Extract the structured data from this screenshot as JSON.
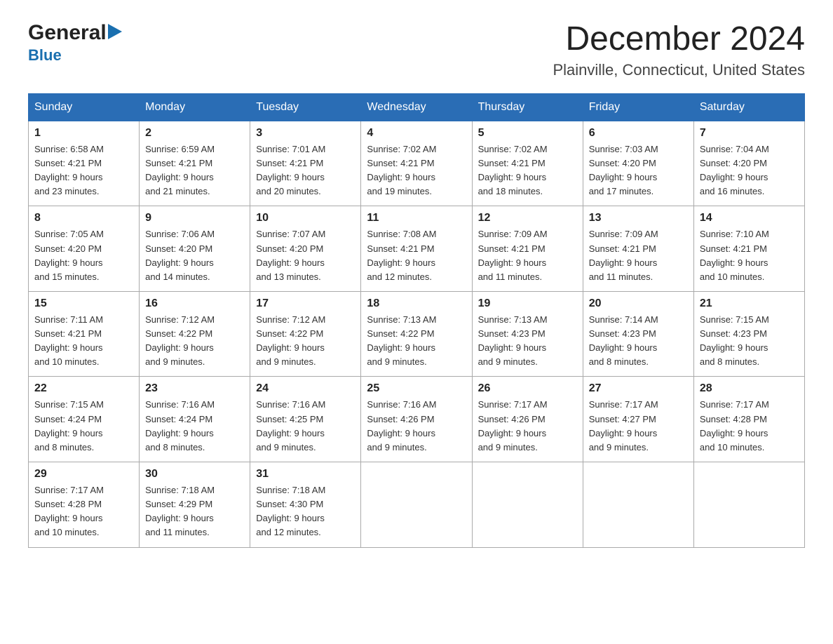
{
  "logo": {
    "general": "General",
    "blue": "Blue",
    "arrow_unicode": "▶"
  },
  "header": {
    "month_title": "December 2024",
    "location": "Plainville, Connecticut, United States"
  },
  "weekdays": [
    "Sunday",
    "Monday",
    "Tuesday",
    "Wednesday",
    "Thursday",
    "Friday",
    "Saturday"
  ],
  "weeks": [
    [
      {
        "num": "1",
        "sunrise": "6:58 AM",
        "sunset": "4:21 PM",
        "daylight": "9 hours and 23 minutes."
      },
      {
        "num": "2",
        "sunrise": "6:59 AM",
        "sunset": "4:21 PM",
        "daylight": "9 hours and 21 minutes."
      },
      {
        "num": "3",
        "sunrise": "7:01 AM",
        "sunset": "4:21 PM",
        "daylight": "9 hours and 20 minutes."
      },
      {
        "num": "4",
        "sunrise": "7:02 AM",
        "sunset": "4:21 PM",
        "daylight": "9 hours and 19 minutes."
      },
      {
        "num": "5",
        "sunrise": "7:02 AM",
        "sunset": "4:21 PM",
        "daylight": "9 hours and 18 minutes."
      },
      {
        "num": "6",
        "sunrise": "7:03 AM",
        "sunset": "4:20 PM",
        "daylight": "9 hours and 17 minutes."
      },
      {
        "num": "7",
        "sunrise": "7:04 AM",
        "sunset": "4:20 PM",
        "daylight": "9 hours and 16 minutes."
      }
    ],
    [
      {
        "num": "8",
        "sunrise": "7:05 AM",
        "sunset": "4:20 PM",
        "daylight": "9 hours and 15 minutes."
      },
      {
        "num": "9",
        "sunrise": "7:06 AM",
        "sunset": "4:20 PM",
        "daylight": "9 hours and 14 minutes."
      },
      {
        "num": "10",
        "sunrise": "7:07 AM",
        "sunset": "4:20 PM",
        "daylight": "9 hours and 13 minutes."
      },
      {
        "num": "11",
        "sunrise": "7:08 AM",
        "sunset": "4:21 PM",
        "daylight": "9 hours and 12 minutes."
      },
      {
        "num": "12",
        "sunrise": "7:09 AM",
        "sunset": "4:21 PM",
        "daylight": "9 hours and 11 minutes."
      },
      {
        "num": "13",
        "sunrise": "7:09 AM",
        "sunset": "4:21 PM",
        "daylight": "9 hours and 11 minutes."
      },
      {
        "num": "14",
        "sunrise": "7:10 AM",
        "sunset": "4:21 PM",
        "daylight": "9 hours and 10 minutes."
      }
    ],
    [
      {
        "num": "15",
        "sunrise": "7:11 AM",
        "sunset": "4:21 PM",
        "daylight": "9 hours and 10 minutes."
      },
      {
        "num": "16",
        "sunrise": "7:12 AM",
        "sunset": "4:22 PM",
        "daylight": "9 hours and 9 minutes."
      },
      {
        "num": "17",
        "sunrise": "7:12 AM",
        "sunset": "4:22 PM",
        "daylight": "9 hours and 9 minutes."
      },
      {
        "num": "18",
        "sunrise": "7:13 AM",
        "sunset": "4:22 PM",
        "daylight": "9 hours and 9 minutes."
      },
      {
        "num": "19",
        "sunrise": "7:13 AM",
        "sunset": "4:23 PM",
        "daylight": "9 hours and 9 minutes."
      },
      {
        "num": "20",
        "sunrise": "7:14 AM",
        "sunset": "4:23 PM",
        "daylight": "9 hours and 8 minutes."
      },
      {
        "num": "21",
        "sunrise": "7:15 AM",
        "sunset": "4:23 PM",
        "daylight": "9 hours and 8 minutes."
      }
    ],
    [
      {
        "num": "22",
        "sunrise": "7:15 AM",
        "sunset": "4:24 PM",
        "daylight": "9 hours and 8 minutes."
      },
      {
        "num": "23",
        "sunrise": "7:16 AM",
        "sunset": "4:24 PM",
        "daylight": "9 hours and 8 minutes."
      },
      {
        "num": "24",
        "sunrise": "7:16 AM",
        "sunset": "4:25 PM",
        "daylight": "9 hours and 9 minutes."
      },
      {
        "num": "25",
        "sunrise": "7:16 AM",
        "sunset": "4:26 PM",
        "daylight": "9 hours and 9 minutes."
      },
      {
        "num": "26",
        "sunrise": "7:17 AM",
        "sunset": "4:26 PM",
        "daylight": "9 hours and 9 minutes."
      },
      {
        "num": "27",
        "sunrise": "7:17 AM",
        "sunset": "4:27 PM",
        "daylight": "9 hours and 9 minutes."
      },
      {
        "num": "28",
        "sunrise": "7:17 AM",
        "sunset": "4:28 PM",
        "daylight": "9 hours and 10 minutes."
      }
    ],
    [
      {
        "num": "29",
        "sunrise": "7:17 AM",
        "sunset": "4:28 PM",
        "daylight": "9 hours and 10 minutes."
      },
      {
        "num": "30",
        "sunrise": "7:18 AM",
        "sunset": "4:29 PM",
        "daylight": "9 hours and 11 minutes."
      },
      {
        "num": "31",
        "sunrise": "7:18 AM",
        "sunset": "4:30 PM",
        "daylight": "9 hours and 12 minutes."
      },
      null,
      null,
      null,
      null
    ]
  ],
  "labels": {
    "sunrise": "Sunrise: ",
    "sunset": "Sunset: ",
    "daylight": "Daylight: "
  },
  "colors": {
    "header_bg": "#2a6db5",
    "header_text": "#ffffff",
    "border": "#aaaaaa"
  }
}
